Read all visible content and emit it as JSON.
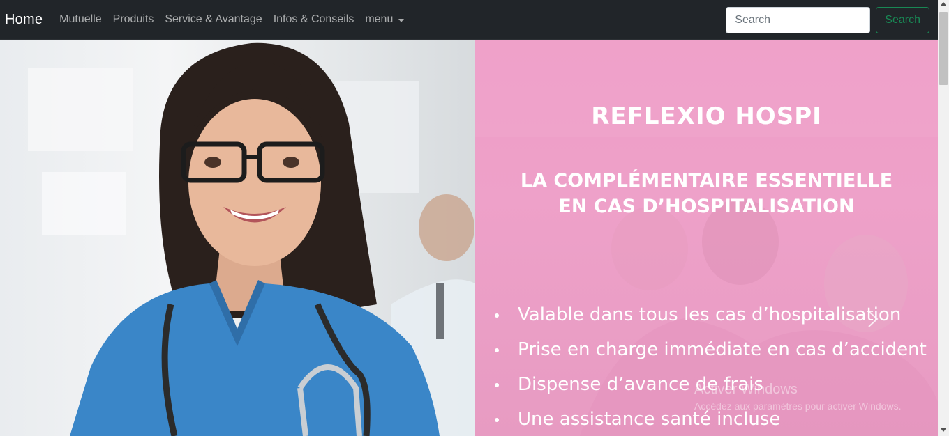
{
  "navbar": {
    "brand": "Home",
    "links": [
      "Mutuelle",
      "Produits",
      "Service & Avantage",
      "Infos & Conseils",
      "menu"
    ],
    "search_placeholder": "Search",
    "search_button": "Search"
  },
  "hero": {
    "title": "REFLEXIO HOSPI",
    "subtitle_line1": "LA COMPLÉMENTAIRE ESSENTIELLE",
    "subtitle_line2": "EN CAS D’HOSPITALISATION",
    "features": [
      "Valable dans tous les cas d’hospitalisation",
      "Prise en charge immédiate en cas d’accident",
      "Dispense d’avance de frais",
      "Une assistance santé incluse"
    ]
  },
  "watermark": {
    "title": "Activer Windows",
    "subtitle": "Accédez aux paramètres pour activer Windows."
  },
  "colors": {
    "navbar_bg": "#212529",
    "panel_pink": "#eea1c9",
    "search_green": "#198754",
    "scrubs_blue": "#3a86c8"
  }
}
